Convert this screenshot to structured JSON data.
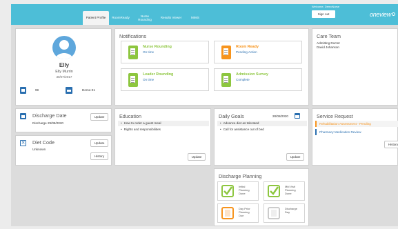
{
  "header": {
    "tabs": [
      {
        "label": "Patient Profile",
        "active": true
      },
      {
        "label": "RoomReady",
        "active": false
      },
      {
        "label": "Nurse\nRounding",
        "active": false
      },
      {
        "label": "Results Viewer",
        "active": false
      },
      {
        "label": "MIMS",
        "active": false
      }
    ],
    "welcome_text": "Welcome, DemoNurse",
    "sign_out_label": "Sign out",
    "logo_text": "oneview",
    "accent_color": "#4dbed7"
  },
  "patient": {
    "name": "Elly",
    "full_name": "Elly Murrin",
    "dob": "30/07/2017",
    "bed": "99",
    "ward": "Demo-01"
  },
  "notifications": {
    "title": "Notifications",
    "items": [
      {
        "title": "Nurse Rounding",
        "status": "On time",
        "color": "#8dc63f"
      },
      {
        "title": "Room Ready",
        "status": "Pending Action",
        "color": "#f7941d"
      },
      {
        "title": "Leader Rounding",
        "status": "On time",
        "color": "#8dc63f"
      },
      {
        "title": "Admission Survey",
        "status": "Complete",
        "color": "#8dc63f"
      }
    ]
  },
  "care_team": {
    "title": "Care Team",
    "role": "Admitting Doctor",
    "name": "David Johanson"
  },
  "discharge_date": {
    "title": "Discharge Date",
    "value": "Discharge 29/08/2020",
    "update_label": "Update"
  },
  "diet_code": {
    "title": "Diet Code",
    "value": "Unknown",
    "update_label": "Update",
    "history_label": "History"
  },
  "education": {
    "title": "Education",
    "items": [
      "How to order a guest meal",
      "Rights and responsibilities"
    ],
    "update_label": "Update"
  },
  "daily_goals": {
    "title": "Daily Goals",
    "date": "28/08/2020",
    "items": [
      "Advance diet as tolerated",
      "Call for assistance out of bed"
    ],
    "update_label": "Update"
  },
  "service_request": {
    "title": "Service Request",
    "items": [
      {
        "label": "Rehabilitation Assessment - Pending",
        "color": "#f7941d"
      },
      {
        "label": "Pharmacy Medication Review",
        "color": "#2a6fb0"
      }
    ],
    "history_label": "History"
  },
  "discharge_planning": {
    "title": "Discharge Planning",
    "items": [
      {
        "label": "Initial\nPlanning\nDone",
        "state": "done"
      },
      {
        "label": "Mid Visit\nPlanning\nDone",
        "state": "done"
      },
      {
        "label": "Day Prior\nPlanning\nDue",
        "state": "due"
      },
      {
        "label": "Discharge\nDay",
        "state": "none"
      }
    ]
  }
}
